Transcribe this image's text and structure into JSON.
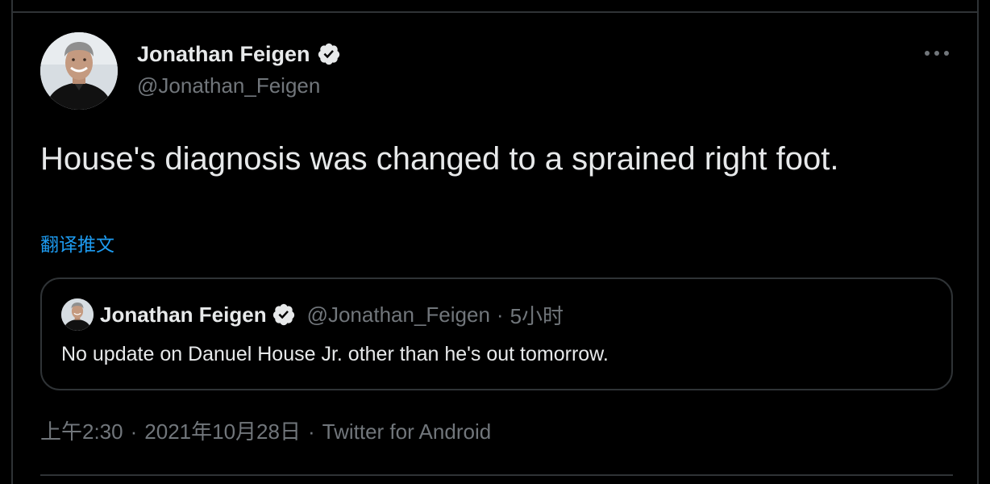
{
  "tweet": {
    "author": {
      "name": "Jonathan Feigen",
      "handle": "@Jonathan_Feigen",
      "verified": true
    },
    "text": "House's diagnosis was changed to a sprained right foot.",
    "translate_label": "翻译推文",
    "more_icon": "more-horizontal-icon",
    "quoted": {
      "name": "Jonathan Feigen",
      "handle": "@Jonathan_Feigen",
      "separator": "·",
      "time": "5小时",
      "text": "No update on Danuel House Jr. other than he's out tomorrow."
    },
    "meta": {
      "time": "上午2:30",
      "date": "2021年10月28日",
      "source": "Twitter for Android",
      "separator": "·"
    }
  },
  "colors": {
    "background": "#000000",
    "text_primary": "#e7e9ea",
    "text_secondary": "#71767b",
    "accent": "#1d9bf0",
    "border": "#2f3336"
  }
}
